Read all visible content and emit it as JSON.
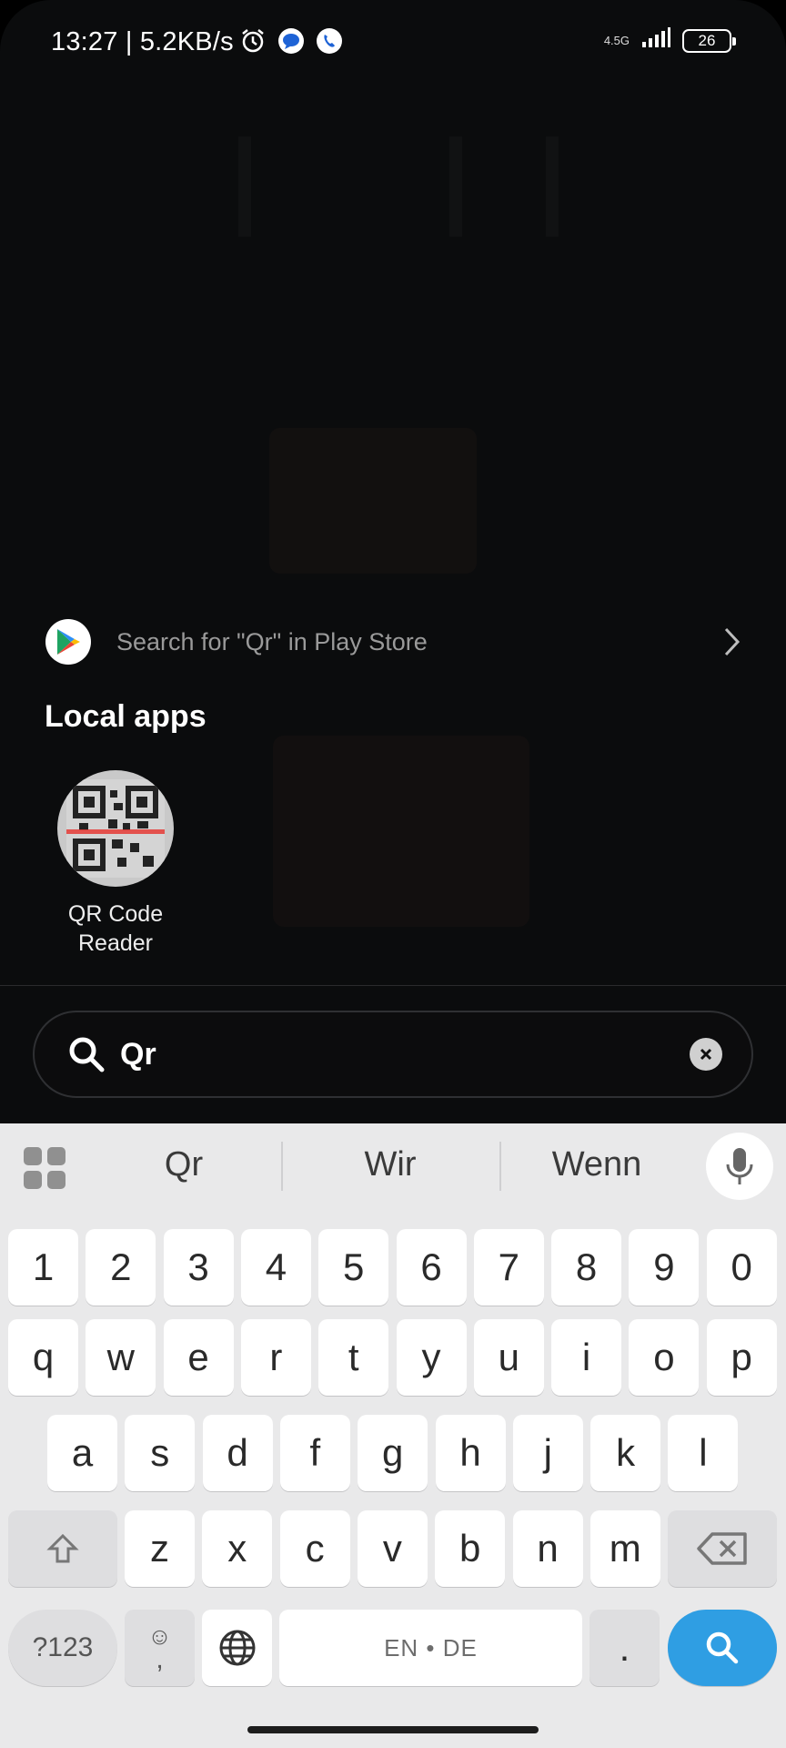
{
  "status_bar": {
    "time": "13:27 | 5.2KB/s",
    "network_label": "4.5G",
    "battery_level": "26",
    "icons": [
      "alarm-icon",
      "messages-icon",
      "phone-call-icon",
      "signal-icon",
      "battery-icon"
    ]
  },
  "play_store_suggestion": {
    "text": "Search for \"Qr\" in Play Store",
    "icon": "play-store-icon"
  },
  "local_apps": {
    "title": "Local apps",
    "apps": [
      {
        "label": "QR Code Reader",
        "icon": "qr-code-reader-icon"
      }
    ]
  },
  "search": {
    "value": "Qr",
    "icon": "search-icon",
    "clear_icon": "clear-icon"
  },
  "keyboard": {
    "suggestions": [
      "Qr",
      "Wir",
      "Wenn"
    ],
    "number_row": [
      "1",
      "2",
      "3",
      "4",
      "5",
      "6",
      "7",
      "8",
      "9",
      "0"
    ],
    "row1": [
      "q",
      "w",
      "e",
      "r",
      "t",
      "y",
      "u",
      "i",
      "o",
      "p"
    ],
    "row2": [
      "a",
      "s",
      "d",
      "f",
      "g",
      "h",
      "j",
      "k",
      "l"
    ],
    "row3": [
      "z",
      "x",
      "c",
      "v",
      "b",
      "n",
      "m"
    ],
    "symbols_key": "?123",
    "emoji_comma_key": ",",
    "space_label": "EN • DE",
    "period_key": ".",
    "accent_color": "#2f9ee3"
  }
}
